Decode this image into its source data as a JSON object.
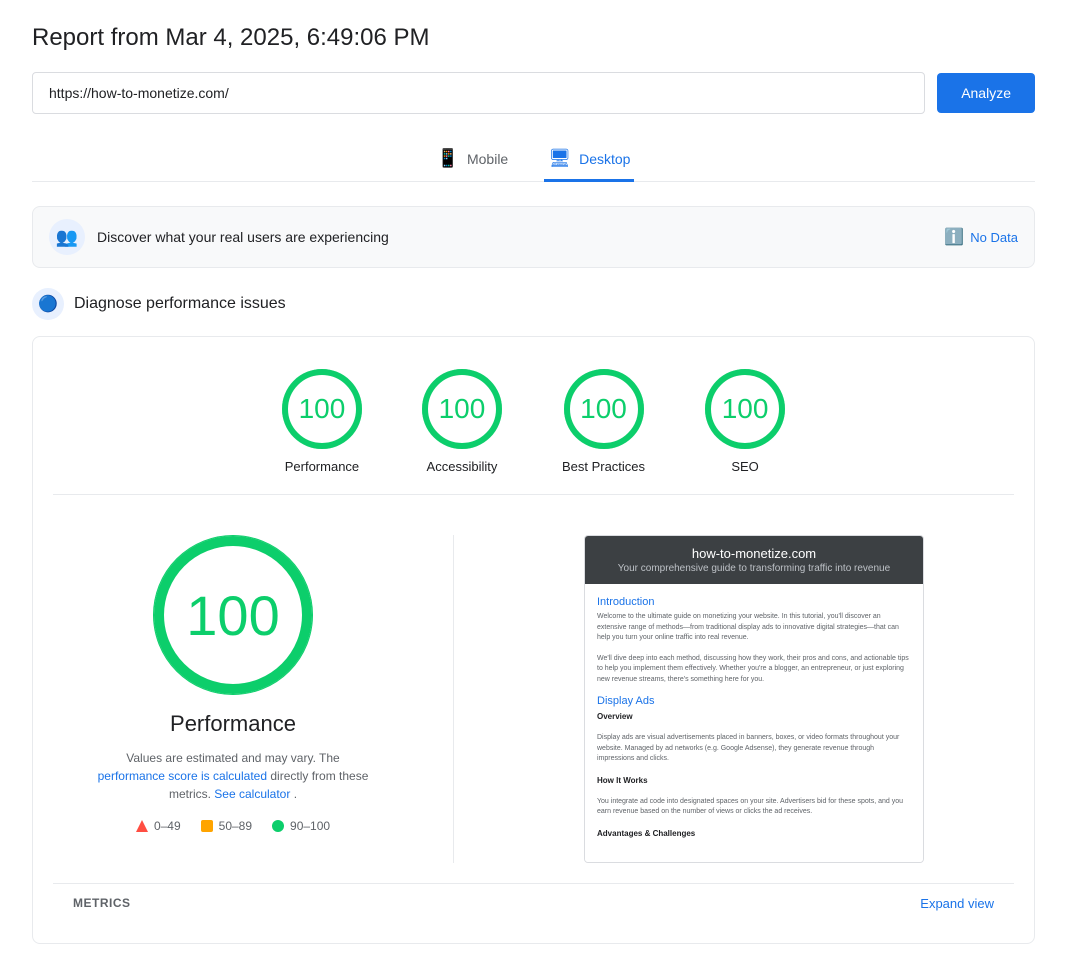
{
  "report": {
    "title": "Report from Mar 4, 2025, 6:49:06 PM"
  },
  "url_bar": {
    "url": "https://how-to-monetize.com/",
    "analyze_label": "Analyze"
  },
  "tabs": [
    {
      "id": "mobile",
      "label": "Mobile",
      "icon": "📱",
      "active": false
    },
    {
      "id": "desktop",
      "label": "Desktop",
      "icon": "🖥",
      "active": true
    }
  ],
  "real_users": {
    "text": "Discover what your real users are experiencing",
    "no_data_label": "No Data"
  },
  "diagnose": {
    "title": "Diagnose performance issues"
  },
  "scores": [
    {
      "id": "performance",
      "value": "100",
      "label": "Performance"
    },
    {
      "id": "accessibility",
      "value": "100",
      "label": "Accessibility"
    },
    {
      "id": "best_practices",
      "value": "100",
      "label": "Best Practices"
    },
    {
      "id": "seo",
      "value": "100",
      "label": "SEO"
    }
  ],
  "detail": {
    "big_score": "100",
    "label": "Performance",
    "desc_text": "Values are estimated and may vary. The",
    "desc_link1": "performance score is calculated",
    "desc_mid": "directly from these metrics.",
    "desc_link2": "See calculator",
    "desc_end": "."
  },
  "legend": [
    {
      "type": "triangle",
      "range": "0–49"
    },
    {
      "type": "square",
      "color": "#ffa400",
      "range": "50–89"
    },
    {
      "type": "circle",
      "color": "#0cce6b",
      "range": "90–100"
    }
  ],
  "screenshot": {
    "site_name": "how-to-monetize.com",
    "tagline": "Your comprehensive guide to transforming traffic into revenue",
    "sections": [
      {
        "title": "Introduction",
        "paragraphs": [
          "Welcome to the ultimate guide on monetizing your website. In this tutorial, you'll discover an extensive range of methods—from traditional display ads to innovative digital strategies—that can help you turn your online traffic into real revenue.",
          "We'll dive deep into each method, discussing how they work, their pros and cons, and actionable tips to help you implement them effectively. Whether you're a blogger, an entrepreneur, or just exploring new revenue streams, there's something here for you."
        ]
      },
      {
        "title": "Display Ads",
        "subsections": [
          {
            "heading": "Overview",
            "text": "Display ads are visual advertisements placed in banners, boxes, or video formats throughout your website. Managed by ad networks (e.g. Google Adsense), they generate revenue through impressions and clicks."
          },
          {
            "heading": "How It Works",
            "text": "You integrate ad code into designated spaces on your site. Advertisers bid for these spots, and you earn revenue based on the number of views or clicks the ad receives."
          },
          {
            "heading": "Advantages & Challenges",
            "text": ""
          }
        ]
      }
    ]
  },
  "metrics_bar": {
    "label": "METRICS",
    "expand_label": "Expand view"
  }
}
